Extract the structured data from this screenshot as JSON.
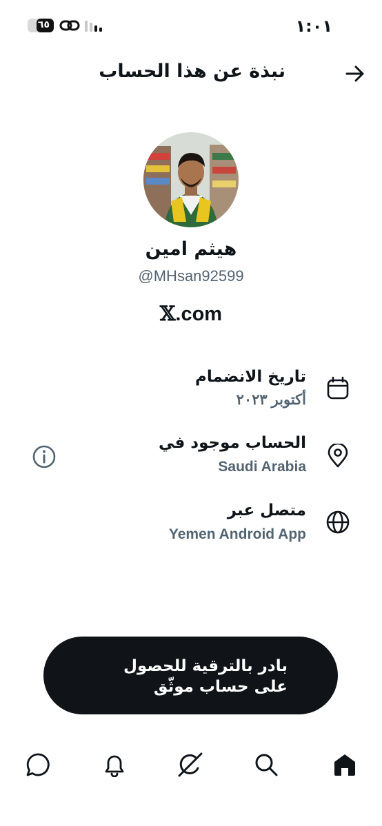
{
  "status_bar": {
    "time": "١:٠١",
    "battery_level": "٦٥",
    "battery_fraction": 0.65
  },
  "header": {
    "title": "نبذة عن هذا الحساب",
    "back_icon": "arrow-right-icon"
  },
  "profile": {
    "display_name": "هيثم امين",
    "handle": "@MHsan92599",
    "site_prefix": "𝕏",
    "site_suffix": ".com"
  },
  "info_rows": [
    {
      "label": "تاريخ الانضمام",
      "value": "أكتوبر ٢٠٢٣",
      "icon": "calendar-icon"
    },
    {
      "label": "الحساب موجود في",
      "value": "Saudi Arabia",
      "icon": "location-pin-icon"
    },
    {
      "label": "متصل عبر",
      "value": "Yemen Android App",
      "icon": "globe-icon"
    }
  ],
  "upgrade": {
    "text": "بادر بالترقية للحصول على حساب موثّق"
  },
  "bottom_nav": [
    "home-icon",
    "search-icon",
    "grok-icon",
    "notifications-icon",
    "messages-icon"
  ],
  "colors": {
    "text_primary": "#0f1419",
    "text_secondary": "#536471",
    "pill_background": "#101418"
  }
}
